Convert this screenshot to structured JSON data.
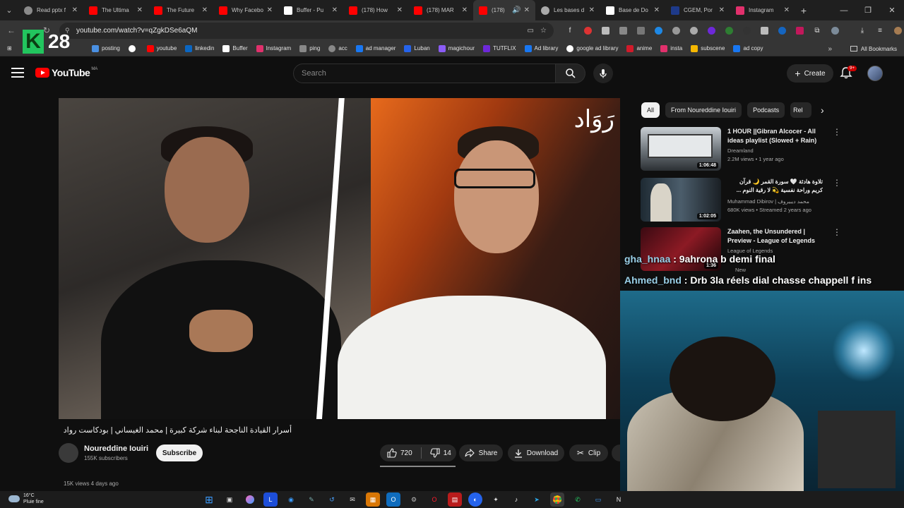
{
  "browser": {
    "tabs": [
      {
        "title": "Read pptx f",
        "color": "#8a8a8a"
      },
      {
        "title": "The Ultima",
        "color": "#ff0000"
      },
      {
        "title": "The Future",
        "color": "#ff0000"
      },
      {
        "title": "Why Facebo",
        "color": "#ff0000"
      },
      {
        "title": "Buffer - Pu",
        "color": "#ffffff"
      },
      {
        "title": "(178) How",
        "color": "#ff0000"
      },
      {
        "title": "(178) MAR",
        "color": "#ff0000"
      },
      {
        "title": "(178)",
        "color": "#ff0000"
      },
      {
        "title": "Les bases d",
        "color": "#aaaaaa"
      },
      {
        "title": "Base de Do",
        "color": "#ffffff"
      },
      {
        "title": "CGEM, Por",
        "color": "#1e3a8a"
      },
      {
        "title": "Instagram",
        "color": "#e1306c"
      }
    ],
    "url": "youtube.com/watch?v=qZgkDSe6aQM",
    "bookmarks": [
      {
        "label": "posting",
        "color": "#4a90e2"
      },
      {
        "label": "",
        "color": "#ffffff"
      },
      {
        "label": "youtube",
        "color": "#ff0000"
      },
      {
        "label": "linkedin",
        "color": "#0a66c2"
      },
      {
        "label": "Buffer",
        "color": "#ffffff"
      },
      {
        "label": "Instagram",
        "color": "#e1306c"
      },
      {
        "label": "ping",
        "color": "#888888"
      },
      {
        "label": "acc",
        "color": "#888888"
      },
      {
        "label": "ad manager",
        "color": "#1877f2"
      },
      {
        "label": "Luban",
        "color": "#2563eb"
      },
      {
        "label": "magichour",
        "color": "#8b5cf6"
      },
      {
        "label": "TUTFLIX",
        "color": "#6d28d9"
      },
      {
        "label": "Ad library",
        "color": "#1877f2"
      },
      {
        "label": "google ad library",
        "color": "#ffffff"
      },
      {
        "label": "anime",
        "color": "#d11a2a"
      },
      {
        "label": "insta",
        "color": "#e1306c"
      },
      {
        "label": "subscene",
        "color": "#f5b700"
      },
      {
        "label": "ad copy",
        "color": "#1877f2"
      }
    ],
    "all_bookmarks_label": "All Bookmarks"
  },
  "overlay": {
    "logo_letter": "K",
    "logo_number": "28"
  },
  "youtube": {
    "logo_text": "YouTube",
    "country_code": "MA",
    "search_placeholder": "Search",
    "create_label": "Create",
    "notifications_badge": "9+"
  },
  "video": {
    "watermark": "رَوَاد",
    "title": "أسرار القيادة الناجحة لبناء شركة كبيرة | محمد الغيساني | بودكاست رواد",
    "channel": "Noureddine Iouiri",
    "subscribers": "155K subscribers",
    "subscribe_label": "Subscribe",
    "likes": "720",
    "dislikes": "14",
    "share_label": "Share",
    "download_label": "Download",
    "clip_label": "Clip",
    "description_peek": "15K views  4 days ago"
  },
  "sidebar": {
    "chips": [
      "All",
      "From Noureddine Iouiri",
      "Podcasts",
      "Rel"
    ],
    "recommendations": [
      {
        "title": "1 HOUR ||Gibran Alcocer - All ideas playlist (Slowed + Rain)",
        "channel": "Dreamland",
        "meta": "2.2M views • 1 year ago",
        "duration": "1:06:48"
      },
      {
        "title": "تلاوة هادئة 🤍 سورة القمر 🌙 قرآن كريم وراحة نفسية 💫 لا رقية النوم ...",
        "channel": "Muhammad Dibirov | محمد ديبيروف",
        "meta": "680K views • Streamed 2 years ago",
        "duration": "1:02:05"
      },
      {
        "title": "Zaahen, the Unsundered | Preview - League of Legends",
        "channel": "League of Legends",
        "meta": "New",
        "duration": "1:36"
      }
    ]
  },
  "chat": [
    {
      "user": "gha_hnaa",
      "message": " : 9ahrona b demi final"
    },
    {
      "user": "Ahmed_bnd",
      "message": " : Drb 3la réels dial chasse chappell f ins"
    }
  ],
  "taskbar": {
    "temperature": "16°C",
    "weather": "Pluie fine"
  }
}
